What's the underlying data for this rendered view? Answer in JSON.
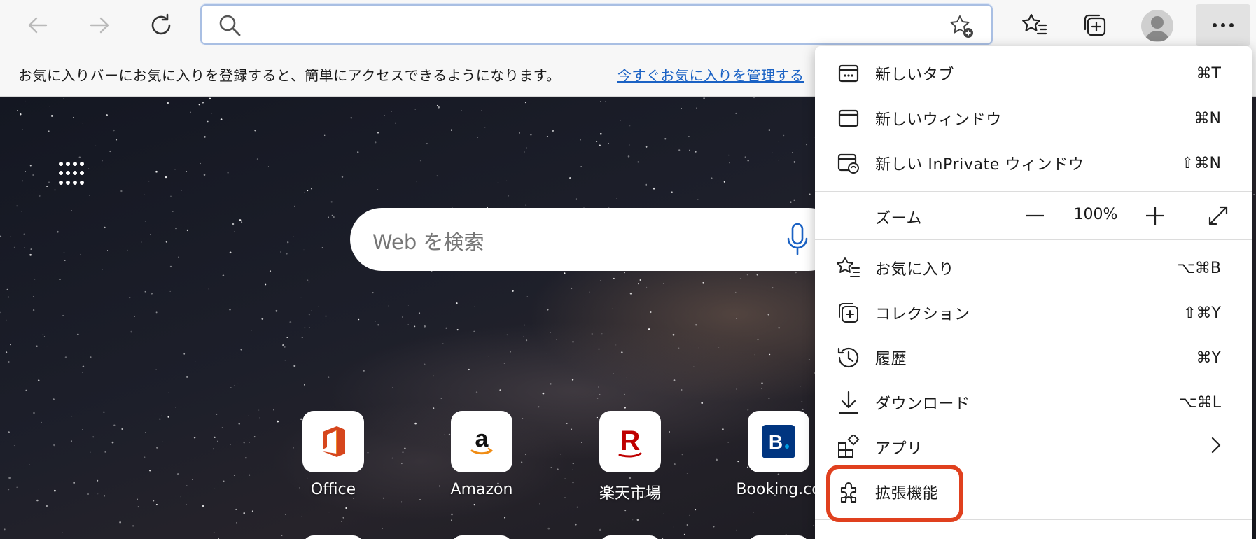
{
  "toolbar": {
    "back_icon": "arrow-left-icon",
    "forward_icon": "arrow-right-icon",
    "refresh_icon": "refresh-icon",
    "address_value": "",
    "favorites_icon": "favorites-list-icon",
    "collections_icon": "collections-icon",
    "profile_icon": "avatar",
    "more_icon": "more-dots-icon"
  },
  "favorites_bar": {
    "message": "お気に入りバーにお気に入りを登録すると、簡単にアクセスできるようになります。",
    "link": "今すぐお気に入りを管理する"
  },
  "new_tab": {
    "search_placeholder": "Web を検索",
    "tiles": [
      {
        "label": "Office",
        "icon": "office-icon"
      },
      {
        "label": "Amazon",
        "icon": "amazon-icon"
      },
      {
        "label": "楽天市場",
        "icon": "rakuten-icon"
      },
      {
        "label": "Booking.co",
        "icon": "booking-icon"
      }
    ]
  },
  "menu": {
    "items": [
      {
        "label": "新しいタブ",
        "shortcut": "⌘T",
        "icon": "new-tab-icon"
      },
      {
        "label": "新しいウィンドウ",
        "shortcut": "⌘N",
        "icon": "new-window-icon"
      },
      {
        "label": "新しい InPrivate ウィンドウ",
        "shortcut": "⇧⌘N",
        "icon": "inprivate-window-icon"
      }
    ],
    "zoom": {
      "label": "ズーム",
      "minus": "—",
      "value": "100%",
      "plus": "+"
    },
    "items2": [
      {
        "label": "お気に入り",
        "shortcut": "⌥⌘B",
        "icon": "favorites-icon"
      },
      {
        "label": "コレクション",
        "shortcut": "⇧⌘Y",
        "icon": "collections-icon"
      },
      {
        "label": "履歴",
        "shortcut": "⌘Y",
        "icon": "history-icon"
      },
      {
        "label": "ダウンロード",
        "shortcut": "⌥⌘L",
        "icon": "download-icon"
      },
      {
        "label": "アプリ",
        "shortcut": "",
        "icon": "apps-icon"
      },
      {
        "label": "拡張機能",
        "shortcut": "",
        "icon": "extensions-icon"
      }
    ]
  },
  "colors": {
    "accent_link": "#1b62c4",
    "highlight": "#e0401e"
  }
}
